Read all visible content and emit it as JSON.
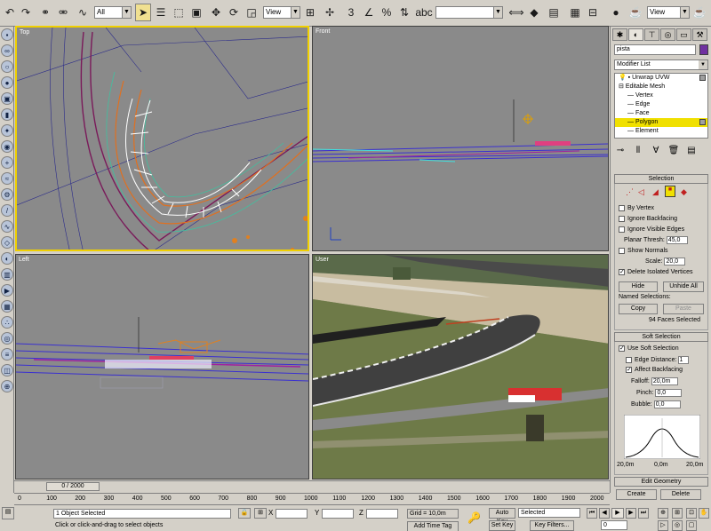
{
  "toolbar": {
    "selection_filter": "All",
    "ref_coord_1": "View",
    "ref_coord_2": "View"
  },
  "viewports": {
    "top_label": "Top",
    "front_label": "Front",
    "left_label": "Left",
    "user_label": "User"
  },
  "command_panel": {
    "object_name": "pista",
    "modifier_list": "Modifier List",
    "stack": {
      "unwrap": "Unwrap UVW",
      "editable_mesh": "Editable Mesh",
      "vertex": "Vertex",
      "edge": "Edge",
      "face": "Face",
      "polygon": "Polygon",
      "element": "Element"
    },
    "selection": {
      "title": "Selection",
      "by_vertex": "By Vertex",
      "ignore_backfacing": "Ignore Backfacing",
      "ignore_visible_edges": "Ignore Visible Edges",
      "planar_thresh_label": "Planar Thresh:",
      "planar_thresh_value": "45,0",
      "show_normals": "Show Normals",
      "scale_label": "Scale:",
      "scale_value": "20,0",
      "delete_isolated": "Delete Isolated Vertices",
      "hide": "Hide",
      "unhide_all": "Unhide All",
      "named_selections": "Named Selections:",
      "copy": "Copy",
      "paste": "Paste",
      "faces_selected": "94 Faces Selected"
    },
    "soft_selection": {
      "title": "Soft Selection",
      "use_soft": "Use Soft Selection",
      "edge_distance": "Edge Distance:",
      "edge_distance_value": "1",
      "affect_backfacing": "Affect Backfacing",
      "falloff_label": "Falloff:",
      "falloff_value": "20,0m",
      "pinch_label": "Pinch:",
      "pinch_value": "0,0",
      "bubble_label": "Bubble:",
      "bubble_value": "0,0",
      "curve_left": "20,0m",
      "curve_mid": "0,0m",
      "curve_right": "20,0m"
    },
    "edit_geometry": {
      "title": "Edit Geometry",
      "create": "Create",
      "delete": "Delete"
    }
  },
  "timeline": {
    "slider_text": "0 / 2000",
    "ticks": [
      "0",
      "100",
      "200",
      "300",
      "400",
      "500",
      "600",
      "700",
      "800",
      "900",
      "1000",
      "1100",
      "1200",
      "1300",
      "1400",
      "1500",
      "1600",
      "1700",
      "1800",
      "1900",
      "2000"
    ]
  },
  "status": {
    "selected_text": "1 Object Selected",
    "prompt_text": "Click or click-and-drag to select objects",
    "x_label": "X",
    "y_label": "Y",
    "z_label": "Z",
    "grid": "Grid = 10,0m",
    "add_time_tag": "Add Time Tag",
    "auto_key": "Auto Key",
    "set_key": "Set Key",
    "key_filter_value": "Selected",
    "key_filters": "Key Filters..."
  },
  "colors": {
    "active_viewport": "#f0d000",
    "selected_stack_item": "#f0e000",
    "object_color": "#7030a0"
  }
}
